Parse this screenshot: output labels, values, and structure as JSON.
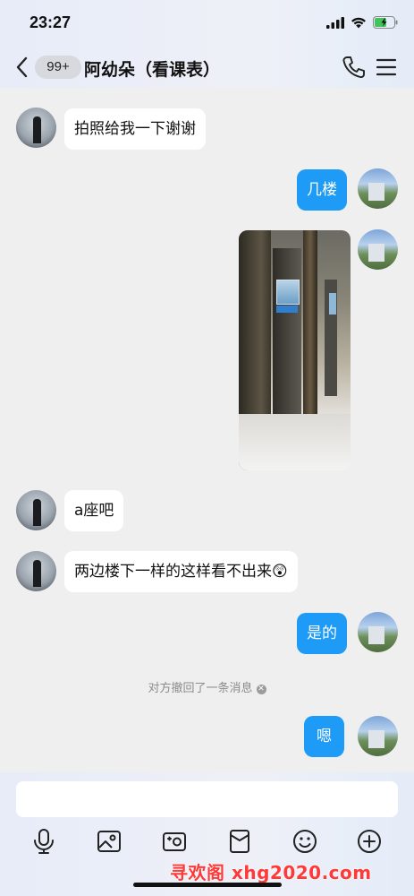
{
  "status_bar": {
    "time": "23:27"
  },
  "header": {
    "unread_badge": "99+",
    "chat_title": "阿幼朵（看课表）"
  },
  "messages": [
    {
      "side": "in",
      "text": "拍照给我一下谢谢"
    },
    {
      "side": "out",
      "text": "几楼"
    },
    {
      "side": "out",
      "type": "image"
    },
    {
      "side": "in",
      "text": "a座吧"
    },
    {
      "side": "in",
      "text": "两边楼下一样的这样看不出来😲"
    },
    {
      "side": "out",
      "text": "是的"
    },
    {
      "side": "system",
      "text": "对方撤回了一条消息"
    },
    {
      "side": "out",
      "text": "嗯"
    }
  ],
  "input": {
    "placeholder": "",
    "value": ""
  },
  "toolbar": [
    "mic-icon",
    "image-icon",
    "camera-icon",
    "red-packet-icon",
    "emoji-icon",
    "plus-icon"
  ],
  "watermark": "寻欢阁 xhg2020.com",
  "colors": {
    "accent": "#1e9bf6",
    "background": "#efefef",
    "watermark": "#ff3838"
  }
}
